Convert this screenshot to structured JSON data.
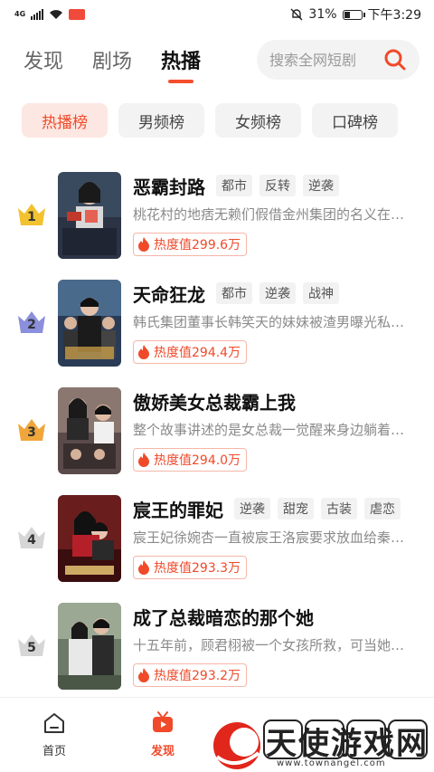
{
  "status_bar": {
    "network": "4G",
    "battery": "31%",
    "time": "下午3:29"
  },
  "top_nav": {
    "tabs": [
      {
        "label": "发现",
        "active": false
      },
      {
        "label": "剧场",
        "active": false
      },
      {
        "label": "热播",
        "active": true
      }
    ],
    "search_placeholder": "搜索全网短剧"
  },
  "chips": [
    {
      "label": "热播榜",
      "active": true
    },
    {
      "label": "男频榜",
      "active": false
    },
    {
      "label": "女频榜",
      "active": false
    },
    {
      "label": "口碑榜",
      "active": false
    }
  ],
  "dramas": [
    {
      "rank": "1",
      "title": "恶霸封路",
      "tags": [
        "都市",
        "反转",
        "逆袭"
      ],
      "desc": "桃花村的地痞无赖们假借金州集团的名义在…",
      "heat": "热度值299.6万",
      "crown_color": "#f3c230"
    },
    {
      "rank": "2",
      "title": "天命狂龙",
      "tags": [
        "都市",
        "逆袭",
        "战神"
      ],
      "desc": "韩氏集团董事长韩笑天的妹妹被渣男曝光私…",
      "heat": "热度值294.4万",
      "crown_color": "#8b8fdc"
    },
    {
      "rank": "3",
      "title": "傲娇美女总裁霸上我",
      "tags": [],
      "desc": "整个故事讲述的是女总裁一觉醒来身边躺着…",
      "heat": "热度值294.0万",
      "crown_color": "#f0a63a"
    },
    {
      "rank": "4",
      "title": "宸王的罪妃",
      "tags": [
        "逆袭",
        "甜宠",
        "古装",
        "虐恋"
      ],
      "desc": "宸王妃徐婉杏一直被宸王洛宸要求放血给秦…",
      "heat": "热度值293.3万",
      "crown_color": "#d6d6d6"
    },
    {
      "rank": "5",
      "title": "成了总裁暗恋的那个她",
      "tags": [],
      "desc": "十五年前，顾君栩被一个女孩所救，可当她…",
      "heat": "热度值293.2万",
      "crown_color": "#d6d6d6"
    }
  ],
  "bottom_nav": [
    {
      "label": "首页",
      "active": false
    },
    {
      "label": "发现",
      "active": true
    }
  ],
  "watermark": {
    "text": "天使游戏网",
    "url": "www.townangel.com"
  },
  "colors": {
    "accent": "#f04a2a",
    "chip_active_bg": "#fde7e2"
  }
}
